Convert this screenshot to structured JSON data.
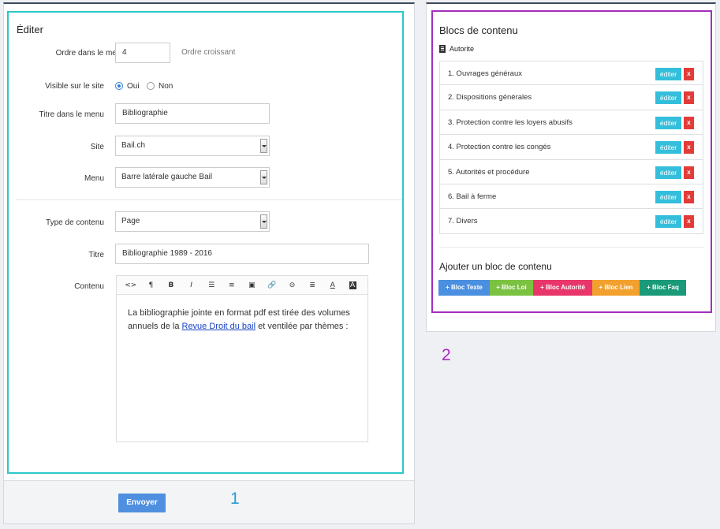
{
  "editor": {
    "title": "Éditer",
    "order_label": "Ordre dans le menu",
    "order_value": "4",
    "order_hint": "Ordre croissant",
    "visible_label": "Visible sur le site",
    "visible_yes": "Oui",
    "visible_no": "Non",
    "visible_selected": "Oui",
    "menu_title_label": "Titre dans le menu",
    "menu_title_value": "Bibliographie",
    "site_label": "Site",
    "site_value": "Bail.ch",
    "menu_label": "Menu",
    "menu_value": "Barre latérale gauche Bail",
    "content_type_label": "Type de contenu",
    "content_type_value": "Page",
    "title_label": "Titre",
    "title_value": "Bibliographie 1989 - 2016",
    "content_label": "Contenu",
    "toolbar_icons": [
      "code-icon",
      "paragraph-icon",
      "bold-icon",
      "italic-icon",
      "bullet-list-icon",
      "numbered-list-icon",
      "image-icon",
      "attach-icon",
      "link-icon",
      "align-icon",
      "text-color-icon",
      "background-color-icon"
    ],
    "toolbar_glyphs": [
      "<>",
      "¶",
      "B",
      "I",
      "☰",
      "≡",
      "▣",
      "🔗",
      "⊝",
      "≣",
      "A",
      "A"
    ],
    "body_text_1": "La bibliographie jointe en format pdf est tirée des volumes annuels de la ",
    "body_link": "Revue Droit du bail",
    "body_text_2": " et ventilée par thèmes :",
    "submit_label": "Envoyer",
    "annotation_number": "1",
    "colors": {
      "highlight": "#2bc7cb",
      "submit": "#4f8fdf",
      "annotation": "#2f9ad8"
    }
  },
  "blocks": {
    "title": "Blocs de contenu",
    "group_label": "Autorite",
    "items": [
      {
        "label": "1. Ouvrages généraux"
      },
      {
        "label": "2. Dispositions générales"
      },
      {
        "label": "3. Protection contre les loyers abusifs"
      },
      {
        "label": "4. Protection contre les congés"
      },
      {
        "label": "5. Autorités et procédure"
      },
      {
        "label": "6. Bail à ferme"
      },
      {
        "label": "7. Divers"
      }
    ],
    "edit_label": "éditer",
    "delete_label": "x",
    "add_title": "Ajouter un bloc de contenu",
    "add_buttons": [
      {
        "label": "+ Bloc Texte",
        "color": "#4a8fe0"
      },
      {
        "label": "+ Bloc Loi",
        "color": "#7cc242"
      },
      {
        "label": "+ Bloc Autorité",
        "color": "#e8366b"
      },
      {
        "label": "+ Bloc Lien",
        "color": "#f2a12e"
      },
      {
        "label": "+ Bloc Faq",
        "color": "#1a9a78"
      }
    ],
    "annotation_number": "2",
    "colors": {
      "highlight": "#a32fbf",
      "edit": "#33bfdb",
      "delete": "#e23c39",
      "annotation": "#b023c6"
    }
  }
}
